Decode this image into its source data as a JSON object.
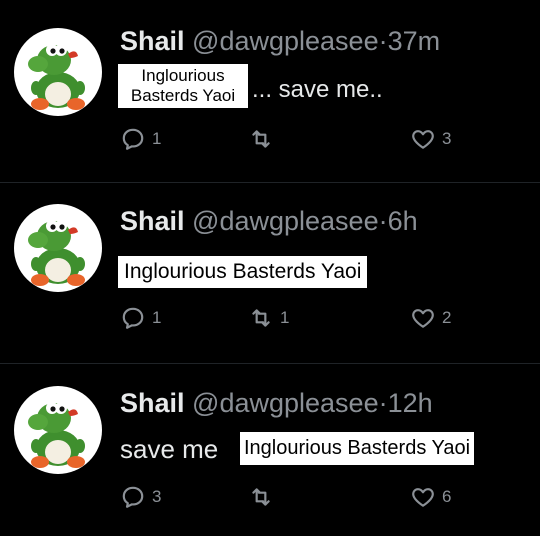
{
  "tweets": [
    {
      "name": "Shail",
      "handle": "@dawgpleasee",
      "separator": "·",
      "time": "37m",
      "caption": "Inglourious Basterds Yaoi",
      "text_after": "... save me..",
      "replies": "1",
      "retweets": "",
      "likes": "3"
    },
    {
      "name": "Shail",
      "handle": "@dawgpleasee",
      "separator": "·",
      "time": "6h",
      "caption": "Inglourious Basterds Yaoi",
      "replies": "1",
      "retweets": "1",
      "likes": "2"
    },
    {
      "name": "Shail",
      "handle": "@dawgpleasee",
      "separator": "·",
      "time": "12h",
      "text_before": "save me",
      "caption": "Inglourious Basterds Yaoi",
      "replies": "3",
      "retweets": "",
      "likes": "6"
    }
  ],
  "avatar_icon": "yoshi-plush-icon",
  "colors": {
    "background": "#000000",
    "text": "#e7e9ea",
    "muted": "#8b9096",
    "caption_bg": "#ffffff",
    "avatar_green": "#3f8f2e"
  }
}
